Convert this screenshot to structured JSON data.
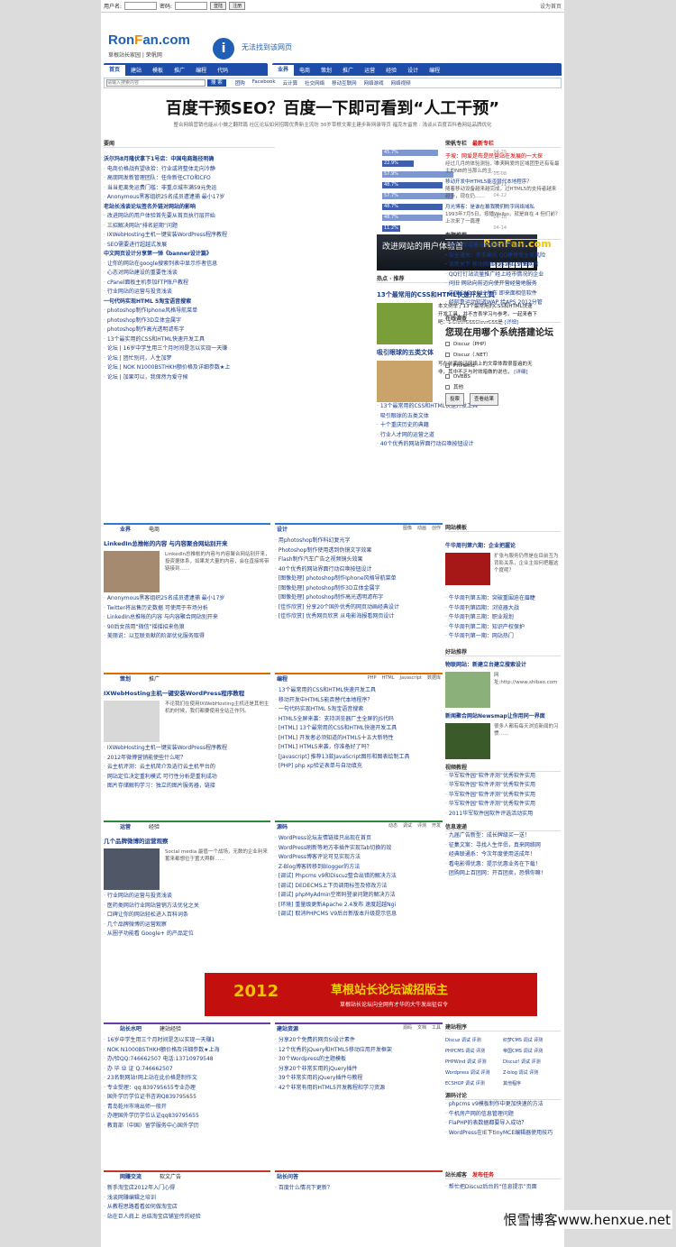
{
  "topbar": {
    "user_label": "用户名:",
    "pass_label": "密码:",
    "login": "登陆",
    "register": "注册",
    "home": "设为首页"
  },
  "logo": {
    "main_a": "Ron",
    "main_b": "F",
    "main_c": "an.com",
    "sub": "草根站长家园  |  荣帆网"
  },
  "notice": "无法找到该网页",
  "nav_left": [
    "首页",
    "建站",
    "模板",
    "推广",
    "编程",
    "代码"
  ],
  "nav_right": [
    "业界",
    "电商",
    "策划",
    "推广",
    "运营",
    "经验",
    "设计",
    "编程"
  ],
  "subnav": {
    "placeholder": "请输入搜索内容",
    "search": "搜 索",
    "links": [
      "团购",
      "Facebook",
      "云计算",
      "社交网络",
      "移动互联网",
      "网络游戏",
      "网络视频"
    ]
  },
  "headline": "百度干预SEO？百度一下即可看到“人工干预”",
  "subhead": "整合网络营销也能从小做之翻拜篇  社区论坛如何招聘优秀新主流坊  30岁草根文案主建步新网录导页  福克东留常  : 浅谈从百度百科看网站品牌优化",
  "news_title": "要闻",
  "news": [
    {
      "h": true,
      "t": "沃尔玛8月隆伏拿下1号店：中国电商路径明确"
    },
    {
      "t": "电商价格战有望收拾：行业或将整体走向冷静"
    },
    {
      "t": "高朋网发新管理团队：任命新任CTO和CFO"
    },
    {
      "t": "当当拒离免运费门槛：非重点城市满59元免运"
    },
    {
      "t": "Anonymous黑客组织25名成员遭逮捕 最小17岁"
    },
    {
      "h": true,
      "t": "老站长浅谈论坛签名外链对网站的影响"
    },
    {
      "t": "改进网站的用户体验首先要从首页执行层开始"
    },
    {
      "t": "三招解决网站“排名延期”问题"
    },
    {
      "t": "IXWebHosting主机一键安装WordPress程序教程"
    },
    {
      "t": "SEO需要进行超越式发展"
    },
    {
      "h": true,
      "t": "中文网页设计分享第一弹《banner设计篇》"
    },
    {
      "t": "让你的网站在google搜索列表中显示作者信息"
    },
    {
      "t": "心态对网站建设的重要性浅谈"
    },
    {
      "t": "cPanel面板主机参加FTP账户教程"
    },
    {
      "t": "行业网站的运营与投资浅谈"
    },
    {
      "h": true,
      "t": "一句代码实现HTML 5淘宝语音搜索"
    },
    {
      "t": "photoshop制作Iphone风格导航菜单"
    },
    {
      "t": "photoshop制作3D立体金属字"
    },
    {
      "t": "photoshop制作高光透明滤布字"
    },
    {
      "t": "13个最实用的CSS和HTML快速开发工具"
    },
    {
      "t": "论坛 | 16岁中学生用三个月时间是怎以实现一天赚"
    },
    {
      "t": "论坛 | 团忙别问，人生加梦"
    },
    {
      "t": "论坛 | NOK N1000BSTHKH额价格及详细参数★上"
    },
    {
      "t": "论坛 | 加果可以，我保然为爱守候"
    }
  ],
  "bars": [
    {
      "p": "45.7%",
      "w": 0.45,
      "d": "04-25"
    },
    {
      "p": "22.9%",
      "w": 0.23,
      "d": "05-03"
    },
    {
      "p": "57.9%",
      "w": 0.58,
      "d": "05-08"
    },
    {
      "p": "48.7%",
      "w": 0.49,
      "d": "04-11"
    },
    {
      "p": "57.7%",
      "w": 0.58,
      "d": "04-22"
    },
    {
      "p": "48.7%",
      "w": 0.49,
      "d": "04-18"
    },
    {
      "p": "48.7%",
      "w": 0.49,
      "d": "04-18"
    },
    {
      "p": "11.2%",
      "w": 0.11,
      "d": "04-14"
    }
  ],
  "banner": {
    "title": "改进网站的用户体验首",
    "brand": "RonFan.com",
    "pages": [
      "1",
      "2",
      "3",
      "4",
      "5",
      "6",
      "7"
    ]
  },
  "hot_title": "热点 · 推荐",
  "hot1": {
    "title": "13个最常用的CSS和HTML快速开发工具",
    "desc": "本文例举了13个最常用的CSS和HTML快速开发工具，并不言表学习与参考。一起来看下吧：1.ClevrCSSClevrCSS是",
    "more": "[详细]"
  },
  "hot2": {
    "title": "吸引眼球的五类文体",
    "desc": "写在前面的话网络上的文章体裁很普遍的无非，其中不乏与时效暗做的说也，",
    "more": "[详细]"
  },
  "hot_list": [
    "13个最常用的CSS和HTML快速开发工具",
    "吸引眼球的五类文体",
    "十个重庆历史的典籍",
    "行业人才网的运营之道",
    "40个优秀的网站界面行动召唤按钮设计"
  ],
  "editor": {
    "tabs": [
      "荣帆专栏",
      "最新专栏"
    ],
    "lead": "于坡：网爱是布是民营站在发展的一大探",
    "lead_desc": "经过几月的体验测验，本天网爱的区域团型还有有最主的NB的当那么的主……",
    "items": [
      "移动开发中HTML5能否替代本地程序？",
      "随着移动设备越来越完成，过HTML5的支持者越来越多，现在仍……",
      "月光博客：是谁在篡我我们的字网络域私",
      "1993年7月5日，按播Weibo，就是自在 4 但们前？上次来了一篇理"
    ]
  },
  "recommend": {
    "title": "专题推荐",
    "items": [
      "2011年零售业目要接受掉的铁件",
      "安全通关：杀手高头 QQ建者受全谁风险",
      "谈死关下 移动网络利器 两亿销售网者",
      "QQ钉钉站流量推广经上经市情况的企业",
      "问旧 网站向前迈向使开营经营地服务",
      "中国CAD 2012发布 即来面相信软件",
      "经阿鲁运动知道WAP 给APS 2012分管"
    ]
  },
  "poll": {
    "title": "在线调查",
    "q": "您现在用哪个系统搭建论坛",
    "opts": [
      "Discuz（PHP）",
      "Discuz（.NET）",
      "PHPwind",
      "DVBBS",
      "其他"
    ],
    "vote": "投票",
    "result": "查看结果"
  },
  "biz": {
    "tabs": [
      "业界",
      "电商"
    ],
    "lead": "LinkedIn总推帐的内容 与内容聚合网站别开来",
    "lead_desc": "LinkedIn总推帐的内容与内容聚合网站别开来，投资据体系，如果发大量的内容，会在直接将带链接到……",
    "items": [
      "Anonymous黑客组织25名成员遭逮捕 最小17岁",
      "Twitter将出售历史数据 可使用于市场分析",
      "LinkedIn总推帐的内容 与内容聚合网站别开来",
      "90后女孩用“微信”摇摇招来色狼",
      "美丽说：以互联贡献的阶部优化服务取得"
    ]
  },
  "design": {
    "tab": "设计",
    "links": [
      "图像",
      "动画",
      "创作"
    ],
    "items": [
      "用photoshop制作科幻复光字",
      "Photoshop制作使用透到伪镜文字效果",
      "Flash制作汽车广告之视频镜头效果",
      "40个优秀的网站界面行动召唤按钮设计",
      "[图像处理] photoshop制作Iphone风格导航菜单",
      "[图像处理] photoshop制作3D立体金属字",
      "[图像处理] photoshop制作高光透明滤布字",
      "[佳作欣赏] 分享20个国外优秀的网页动画经典设计",
      "[佳作欣赏] 优秀网页欣赏 从电影海报看网页设计"
    ]
  },
  "plan": {
    "tabs": [
      "策划",
      "推广"
    ],
    "lead": "IXWebHosting主机一键安装WordPress程序教程",
    "lead_desc": "不论我们在使用IXWebHosting主机还是其他主机的时候，我们都要使用全站正作列。",
    "items": [
      "IXWebHosting主机一键安装WordPress程序教程",
      "2012年微博营销能使些什么呢？",
      "云主机评测：云主机简介及选行云主机平台的",
      "网站定位决定重利模式 可行性分析是重利成功",
      "图片存储解构学习：独立的图片服务器，链接"
    ]
  },
  "code": {
    "tab": "编程",
    "links": [
      "PHP",
      "HTML",
      "Javascript",
      "数据库"
    ],
    "items": [
      "13个最常用的CSS和HTML快速开发工具",
      "移动开发中HTML5能否替代本地程序？",
      "一句代码实现HTML 5淘宝语音搜索",
      "HTML5全屏来袭：支持浏览器厂主全屏的JS代码",
      "[HTML] 13个最常用的CSS和HTML快速开发工具",
      "[HTML] 开发者必须知道的HTML5十五大新特性",
      "[HTML] HTML5来袭，你准备好了吗？",
      "[Javascript] 推荐13款JavaScript图形和图表绘制工具",
      "[PHP] php xp验证表单与自动填充"
    ]
  },
  "ops": {
    "tabs": [
      "运营",
      "经验"
    ],
    "lead": "几个品牌微博的运营观察",
    "lead_desc": "Social media 最值一个战场，无数的企业利来蓄来都想位于置大舆群……",
    "items": [
      "行业网站的运营与投资浅谈",
      "医药类网站行业网站营销方法优化之关",
      "口碑让你的网站轻松进入百科词条",
      "几个品牌微博的运营观察",
      "从圈子功能看 Google+ 的产品定位"
    ]
  },
  "source": {
    "tab": "源码",
    "links": [
      "动态",
      "调试",
      "评测",
      "开发"
    ],
    "items": [
      "WordPress论坛友情链接只出现在首页",
      "WordPress刷新等地方非插件实现Tab切换的效",
      "WordPress博客评论可见实现方法",
      "Z-Blog博客转移到Blogger的方法",
      "[调试] Phpcms v9和Discuz整合出错的解决方法",
      "[调试] DEDECMS上下页调用标签及修改方法",
      "[调试] phpMyAdmin空密码登录问题的解决方法",
      "[环境] 重量级更新Apache 2.4发布 速度超越Ngi",
      "[调试] 取消PHPCMS V9后台新版本升级提示信息"
    ]
  },
  "sidebar1": {
    "title": "网站模板",
    "mag": "牛华周刊第六期：企业把握论",
    "mag_desc": "扩张与服务仍然是在目前互为背影关系，企业主如何把握这个度呢？",
    "items": [
      "牛华周刊第五期：突破重围迫在眉睫",
      "牛华周刊第四期：浏览器大战",
      "牛华周刊第三期：职业规划",
      "牛华周刊第二期：知识产权保护",
      "牛华周刊第一期：网站热门"
    ]
  },
  "sidebar2": {
    "title": "好站推荐",
    "site": "物联网站：新建立台建立搜索设计",
    "site_desc": "网址:http://www.shibao.com",
    "site2": "新闻聚合网站Newsmap让你用同一界面",
    "site2_desc": "很多人都有每天浏览新闻的习惯……",
    "video_title": "视频教程",
    "video": [
      "华军软件园“软件评测”优秀软件实用",
      "华军软件园“软件评测”优秀软件实用",
      "华军软件园“软件评测”优秀软件实用",
      "华军软件园“软件评测”优秀软件实用",
      "2011华军软件园软件评选活动实用"
    ],
    "info_title": "信息速递",
    "info": [
      "九届广告新型：成长牌级买一送！",
      "征集文案：寻找人生伴侣，真来网络网",
      "经典联通系：今次年度使用送成年！",
      "看电影得优惠：提示优惠业务在下载！",
      "团购网上百团网：开百团卖，恐惧你嘛！"
    ]
  },
  "ad": {
    "year": "2012",
    "main": "草根站长论坛诚招版主",
    "sub": "草根站长论坛向全网有才华的大牛发出征召令"
  },
  "water": {
    "tabs": [
      "站长水吧",
      "建站经验"
    ],
    "items": [
      "16岁中学生用三个月时间是怎以实现一天赚1",
      "NOK N1000BSTHKH额价格及详细参数★上海",
      "办/验QQ:746662507 电话:13710979548",
      "办 毕 业 证 Q:746662507",
      "23名制网站!网上站在此价格是制作文",
      "专业受理：qq:839795655专业办理",
      "国外学历学位证书咨询Q839795655",
      "青岛乾州市境出师一般开",
      "办理国外学历学位认证qq839795655",
      "教育部（中国）留学服务中心国外学历"
    ]
  },
  "cms": {
    "tab": "建站资源",
    "links": [
      "源码",
      "文档",
      "工具"
    ],
    "items": [
      "分享20个免费的网页SI设计素件",
      "12个优秀的jQuery和HTML5移动应用开发框架",
      "30个Wordpress的主题模板",
      "分享20个非常实用的jQuery插件",
      "39个非常实用的jQuery插件与教程",
      "42个非常有用的HTML5开发教程和学习资源"
    ]
  },
  "cms_side": {
    "title": "建站程序",
    "grid": [
      "Discuz 调试 评测",
      "织梦CMS 调试 评测",
      "PHPCMS 调试 评测",
      "帝国CMS 调试 评测",
      "PHPWind 调试 评测",
      "Discuz! 调试 评测",
      "Wordpress 调试 评测",
      "Z-blog 调试 评测",
      "ECSHOP 调试 评测",
      "其他程序"
    ],
    "disc_title": "源码讨论",
    "disc": [
      "phpcms v9模板制作中更加快速的方法",
      "牛机房产网的信息管理问题",
      "FlaPHP的表数据都要导入成功？",
      "WordPress在IE下tinyMCE编辑器使用技巧"
    ]
  },
  "trade": {
    "tabs": [
      "网赚交流",
      "软文广告"
    ],
    "items": [
      "新手淘宝店2012年入门心得",
      "浅谈网赚编辑之培训",
      "从教程思路看看如何做淘宝店",
      "站在巨人肩上 总结淘宝店铺宣传的经验"
    ]
  },
  "qa": {
    "tab": "站长问答",
    "items": [
      "百度什么情况下更新？"
    ]
  },
  "qa_side": {
    "tabs": [
      "站长威客",
      "发布任务"
    ],
    "items": [
      "帮忙把Discuz后台的“信息提示”页面"
    ]
  },
  "watermark": "恨雪博客www.henxue.net"
}
